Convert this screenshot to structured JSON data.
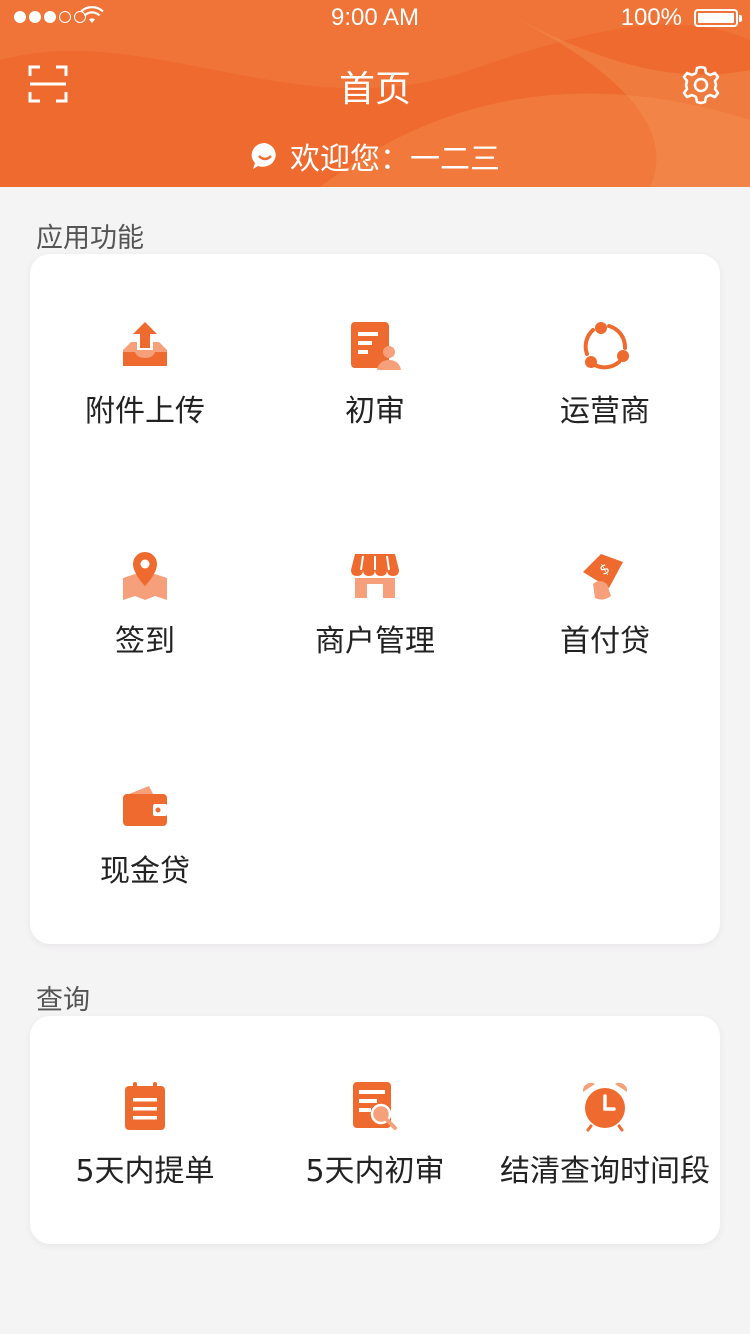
{
  "status_bar": {
    "time": "9:00 AM",
    "battery": "100%"
  },
  "header": {
    "title": "首页",
    "welcome": "欢迎您：一二三"
  },
  "sections": {
    "apps": {
      "label": "应用功能",
      "items": [
        {
          "label": "附件上传",
          "icon": "upload-icon"
        },
        {
          "label": "初审",
          "icon": "document-review-icon"
        },
        {
          "label": "运营商",
          "icon": "share-network-icon"
        },
        {
          "label": "签到",
          "icon": "location-pin-icon"
        },
        {
          "label": "商户管理",
          "icon": "storefront-icon"
        },
        {
          "label": "首付贷",
          "icon": "loan-tag-icon"
        },
        {
          "label": "现金贷",
          "icon": "wallet-icon"
        }
      ]
    },
    "query": {
      "label": "查询",
      "items": [
        {
          "label": "5天内提单",
          "icon": "clipboard-list-icon"
        },
        {
          "label": "5天内初审",
          "icon": "document-search-icon"
        },
        {
          "label": "结清查询时间段",
          "icon": "alarm-clock-icon"
        }
      ]
    }
  },
  "colors": {
    "accent": "#ef6a2e",
    "accent_light": "#f5a07a",
    "background": "#f5f4f5"
  }
}
